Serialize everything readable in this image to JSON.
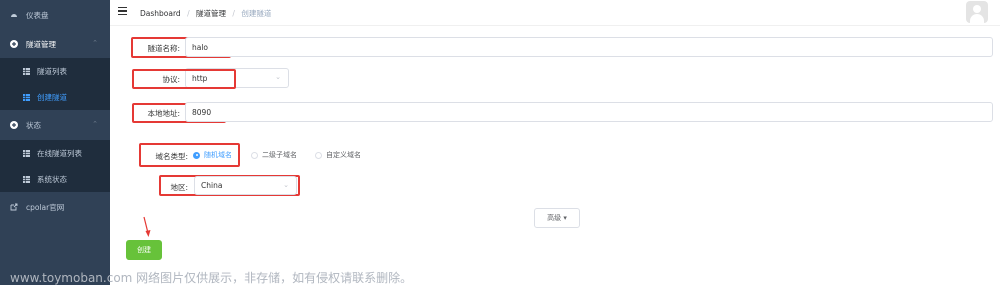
{
  "sidebar": {
    "items": [
      {
        "label": "仪表盘",
        "icon": "dashboard-icon"
      },
      {
        "label": "隧道管理",
        "icon": "plus-circle-icon"
      },
      {
        "label": "隧道列表",
        "icon": "grid-icon"
      },
      {
        "label": "创建隧道",
        "icon": "grid-icon"
      },
      {
        "label": "状态",
        "icon": "plus-circle-icon"
      },
      {
        "label": "在线隧道列表",
        "icon": "grid-icon"
      },
      {
        "label": "系统状态",
        "icon": "grid-icon"
      },
      {
        "label": "cpolar官网",
        "icon": "external-link-icon"
      }
    ]
  },
  "header": {
    "breadcrumb": [
      "Dashboard",
      "隧道管理",
      "创建隧道"
    ],
    "separator": "/"
  },
  "form": {
    "tunnel_name": {
      "label": "隧道名称:",
      "value": "halo"
    },
    "protocol": {
      "label": "协议:",
      "value": "http"
    },
    "local_address": {
      "label": "本地地址:",
      "value": "8090"
    },
    "domain_type": {
      "label": "域名类型:",
      "options": [
        "随机域名",
        "二级子域名",
        "自定义域名"
      ],
      "selected": "随机域名"
    },
    "region": {
      "label": "地区:",
      "value": "China"
    }
  },
  "buttons": {
    "advanced": "高级 ▾",
    "create": "创建"
  },
  "watermark": "www.toymoban.com 网络图片仅供展示，非存储，如有侵权请联系删除。",
  "colors": {
    "sidebar_bg": "#304156",
    "submenu_bg": "#1f2d3d",
    "primary": "#409eff",
    "success": "#67c23a",
    "annotation": "#e53935"
  }
}
